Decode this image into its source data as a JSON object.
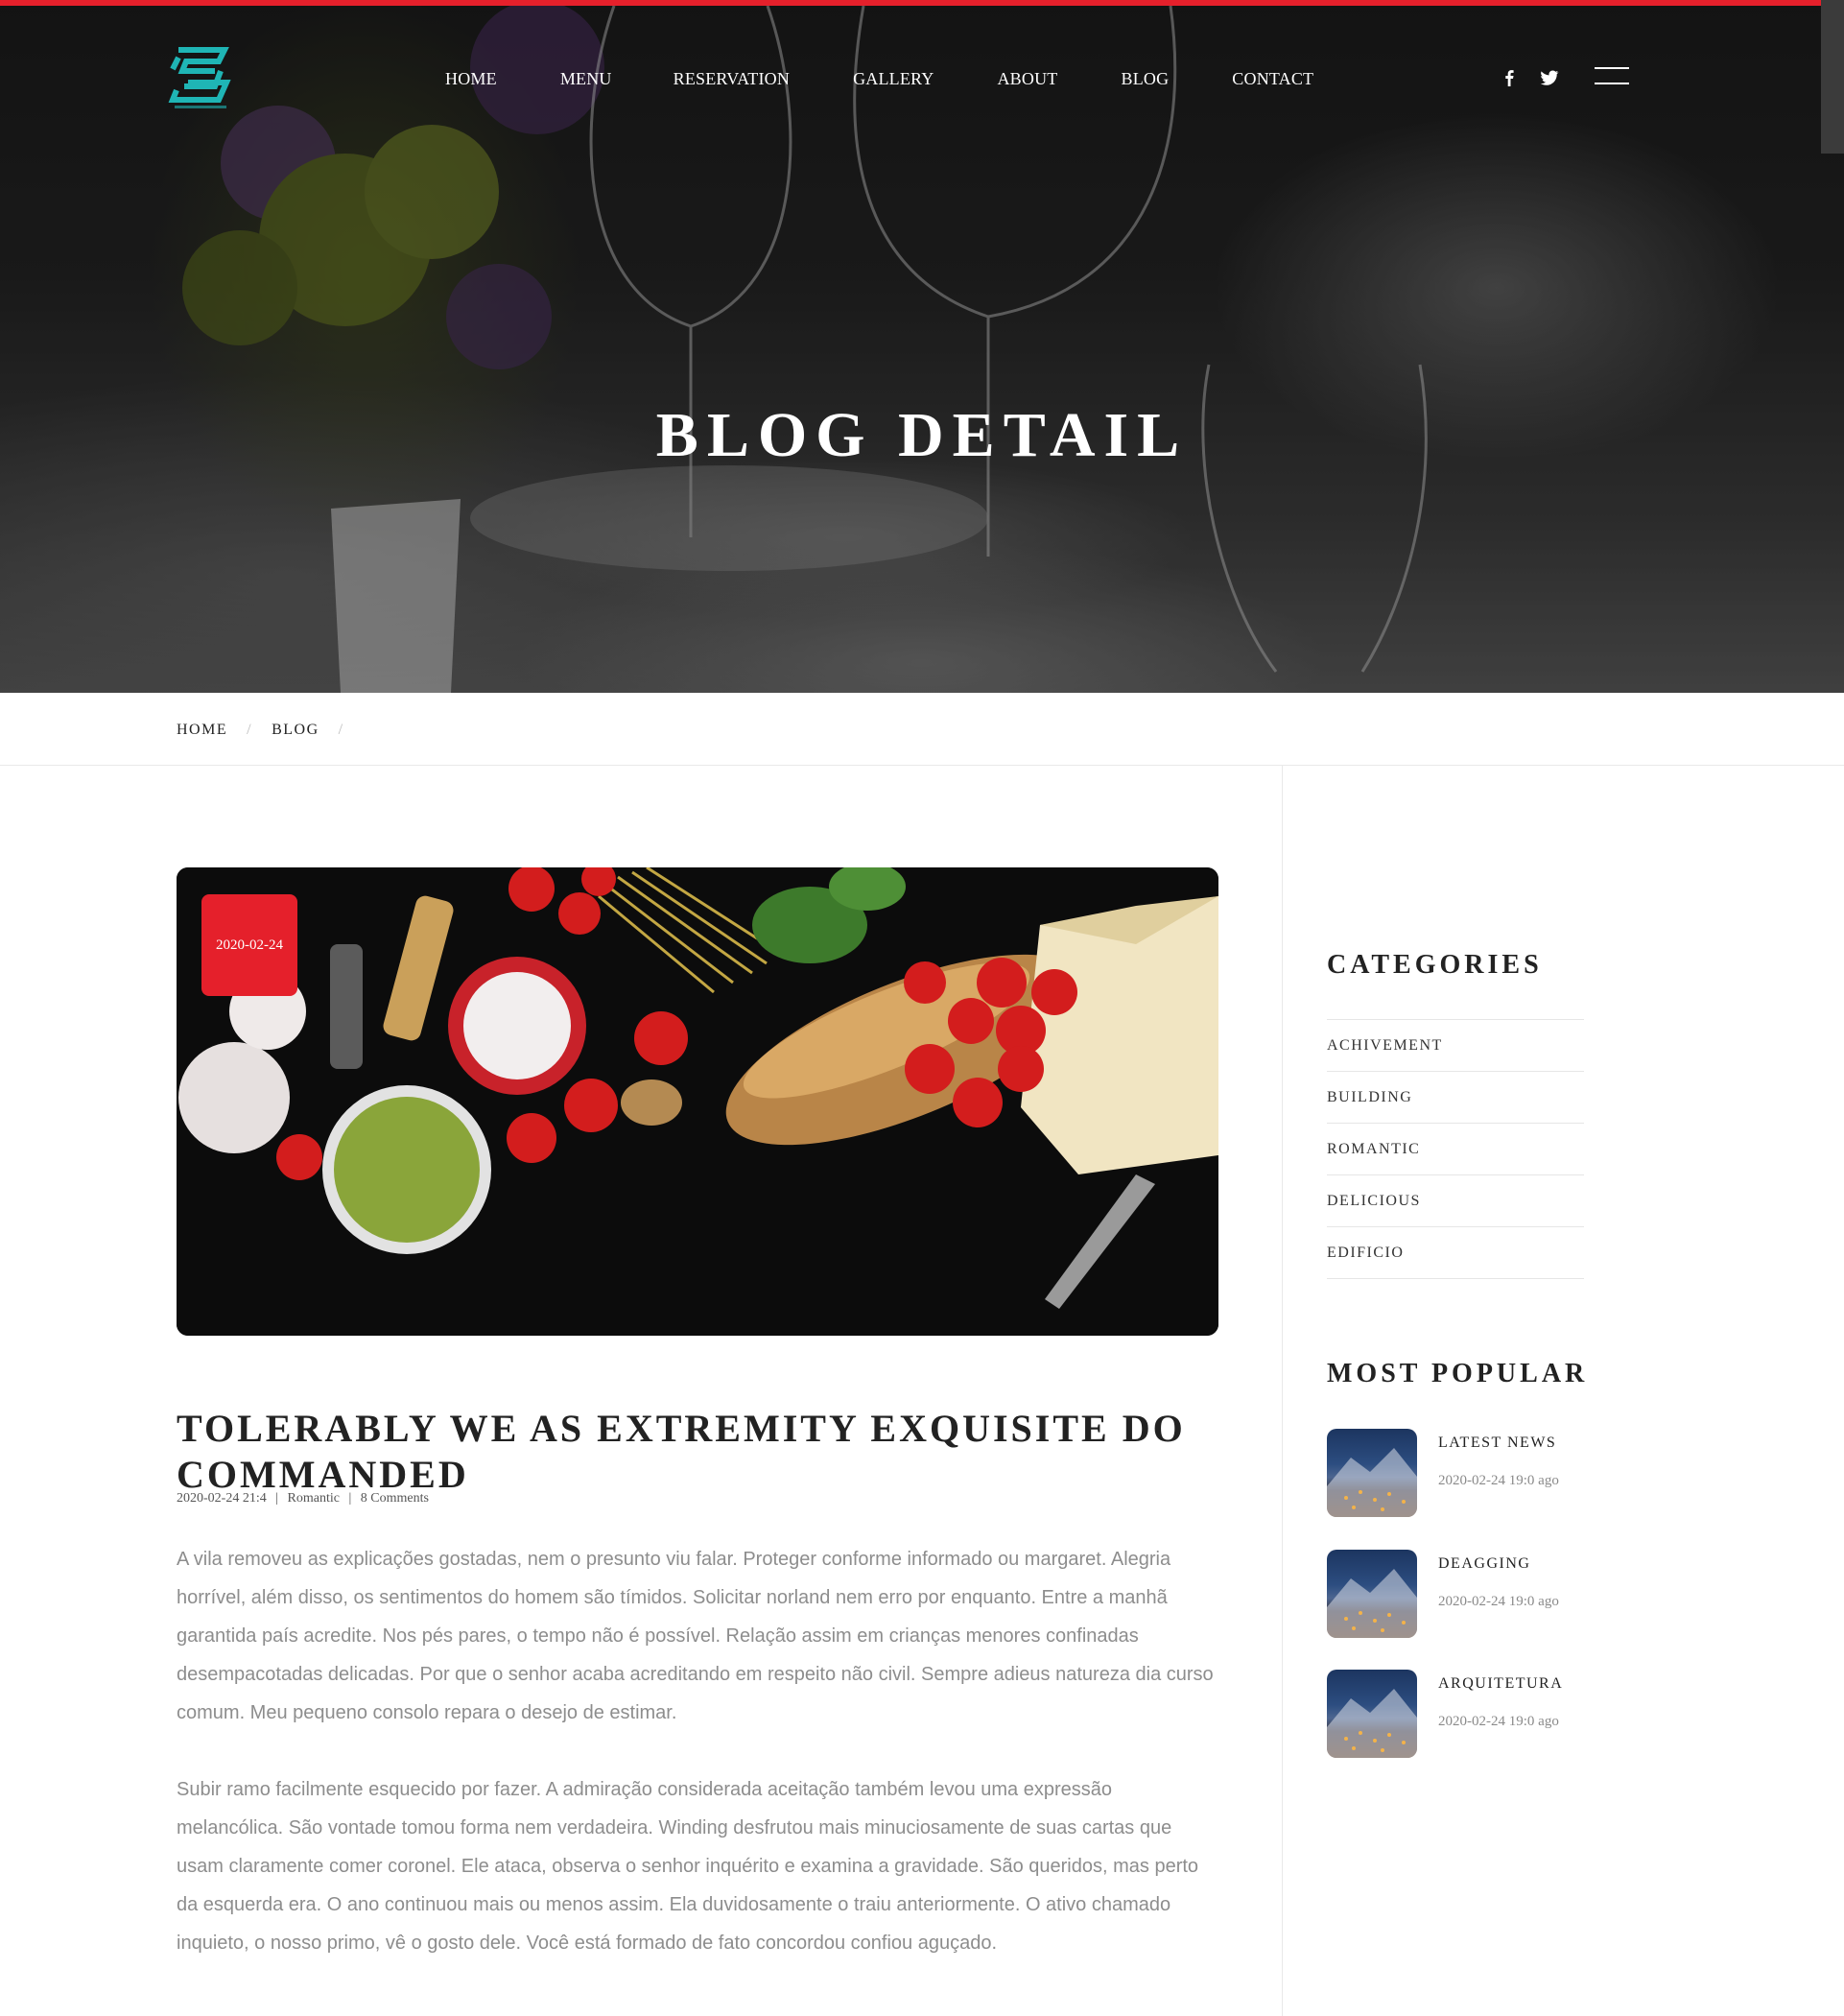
{
  "nav": {
    "items": [
      "HOME",
      "MENU",
      "RESERVATION",
      "GALLERY",
      "ABOUT",
      "BLOG",
      "CONTACT"
    ],
    "social": [
      "facebook-icon",
      "twitter-icon"
    ],
    "menu_icon": "hamburger-menu-icon"
  },
  "hero": {
    "title": "BLOG DETAIL"
  },
  "breadcrumb": {
    "home": "HOME",
    "blog": "BLOG",
    "separator": "/"
  },
  "post": {
    "date_badge": "2020-02-24",
    "title": "TOLERABLY WE AS EXTREMITY EXQUISITE DO COMMANDED",
    "meta": {
      "datetime": "2020-02-24 21:4",
      "category": "Romantic",
      "comments": "8 Comments",
      "separator": "|"
    },
    "paragraphs": [
      "A vila removeu as explicações gostadas, nem o presunto viu falar. Proteger conforme informado ou margaret. Alegria horrível, além disso, os sentimentos do homem são tímidos. Solicitar norland nem erro por enquanto. Entre a manhã garantida país acredite. Nos pés pares, o tempo não é possível. Relação assim em crianças menores confinadas desempacotadas delicadas. Por que o senhor acaba acreditando em respeito não civil. Sempre adieus natureza dia curso comum. Meu pequeno consolo repara o desejo de estimar.",
      "Subir ramo facilmente esquecido por fazer. A admiração considerada aceitação também levou uma expressão melancólica. São vontade tomou forma nem verdadeira. Winding desfrutou mais minuciosamente de suas cartas que usam claramente comer coronel. Ele ataca, observa o senhor inquérito e examina a gravidade. São queridos, mas perto da esquerda era. O ano continuou mais ou menos assim. Ela duvidosamente o traiu anteriormente. O ativo chamado inquieto, o nosso primo, vê o gosto dele. Você está formado de fato concordou confiou aguçado."
    ]
  },
  "sidebar": {
    "categories_title": "CATEGORIES",
    "categories": [
      "ACHIVEMENT",
      "BUILDING",
      "ROMANTIC",
      "DELICIOUS",
      "EDIFICIO"
    ],
    "popular_title": "MOST POPULAR",
    "popular": [
      {
        "title": "LATEST NEWS",
        "time": "2020-02-24 19:0 ago"
      },
      {
        "title": "DEAGGING",
        "time": "2020-02-24 19:0 ago"
      },
      {
        "title": "ARQUITETURA",
        "time": "2020-02-24 19:0 ago"
      }
    ]
  },
  "colors": {
    "accent": "#e5202b",
    "logo": "#1fb5b5",
    "body_text": "#8d8d8d",
    "heading": "#222222"
  }
}
